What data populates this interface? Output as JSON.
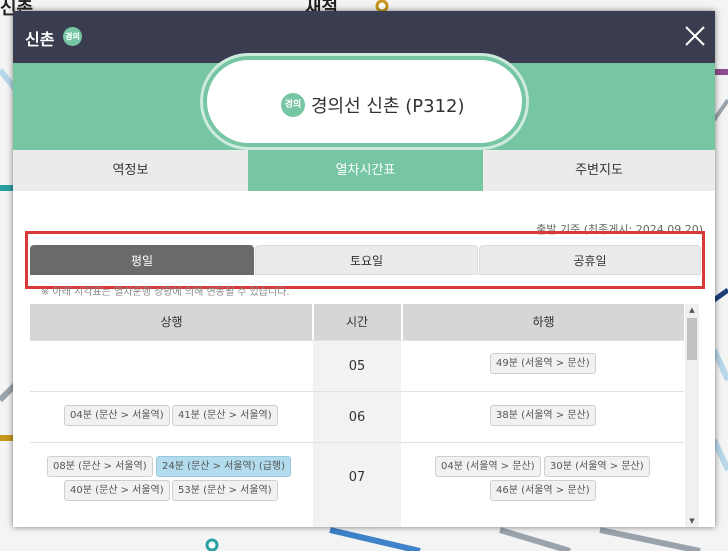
{
  "map_bg": {
    "labels": [
      "신촌",
      "새절"
    ],
    "line_colors": {
      "teal": "#2aa0a0",
      "navy": "#1e3e7a",
      "gray": "#9aa3ab",
      "purple": "#8c4c8c",
      "gold": "#c7961c",
      "blue": "#3e82c9",
      "lightblue": "#b8d7ea"
    }
  },
  "dialog": {
    "title": "신촌",
    "line_badge": "경의",
    "station_name": "경의선 신촌 (P312)",
    "close_icon": "close-icon"
  },
  "main_tabs": [
    {
      "label": "역정보",
      "active": false
    },
    {
      "label": "열차시간표",
      "active": true
    },
    {
      "label": "주변지도",
      "active": false
    }
  ],
  "basis_text": "출발 기준 (최종게시: 2024.09.20)",
  "day_tabs": [
    {
      "label": "평일",
      "active": true
    },
    {
      "label": "토요일",
      "active": false
    },
    {
      "label": "공휴일",
      "active": false
    }
  ],
  "notice": "※ 아래 시각표는 열차운행 상황에 의해 변동될 수 있습니다.",
  "table": {
    "headers": {
      "up": "상행",
      "time": "시간",
      "down": "하행"
    },
    "rows": [
      {
        "hour": "05",
        "up": [],
        "down": [
          {
            "text": "49분 (서울역 > 문산)",
            "express": false
          }
        ]
      },
      {
        "hour": "06",
        "up": [
          {
            "text": "04분 (문산 > 서울역)",
            "express": false
          },
          {
            "text": "41분 (문산 > 서울역)",
            "express": false
          }
        ],
        "down": [
          {
            "text": "38분 (서울역 > 문산)",
            "express": false
          }
        ]
      },
      {
        "hour": "07",
        "up": [
          {
            "text": "08분 (문산 > 서울역)",
            "express": false
          },
          {
            "text": "24분 (문산 > 서울역) (급행)",
            "express": true
          },
          {
            "text": "40분 (문산 > 서울역)",
            "express": false
          },
          {
            "text": "53분 (문산 > 서울역)",
            "express": false
          }
        ],
        "down": [
          {
            "text": "04분 (서울역 > 문산)",
            "express": false
          },
          {
            "text": "30분 (서울역 > 문산)",
            "express": false
          },
          {
            "text": "46분 (서울역 > 문산)",
            "express": false
          }
        ]
      }
    ]
  },
  "colors": {
    "accent": "#77c6a3",
    "titlebar": "#3a3d50",
    "highlight_box": "#d83a3a",
    "active_day_tab": "#6a6a6a",
    "express_chip": "#b3dcee"
  }
}
